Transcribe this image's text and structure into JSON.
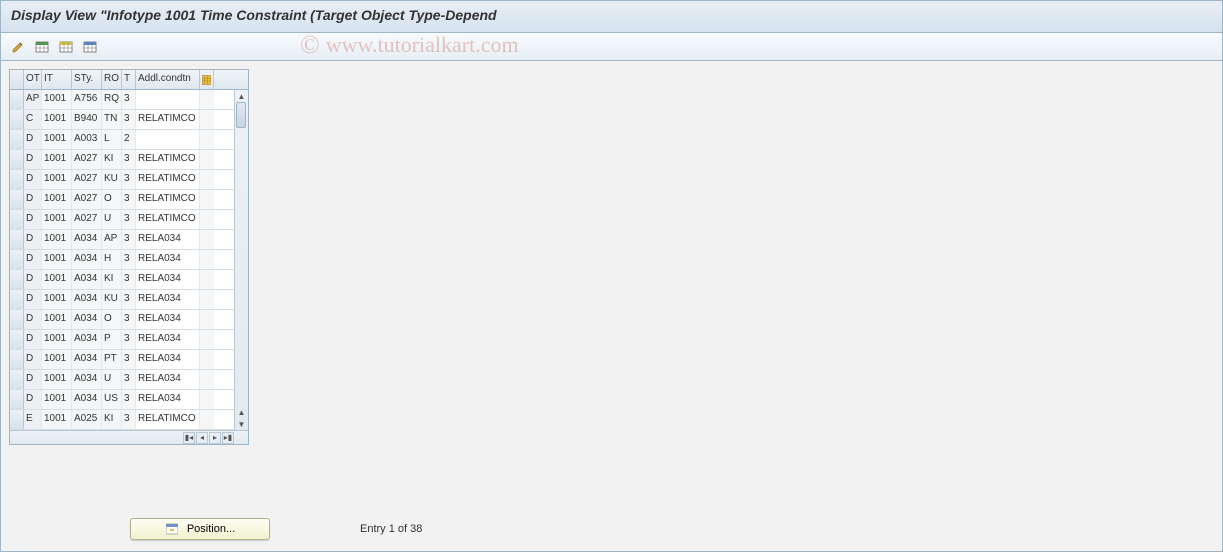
{
  "title": "Display View \"Infotype 1001 Time Constraint (Target Object Type-Depend",
  "watermark": "www.tutorialkart.com",
  "toolbar": {
    "icons": [
      "pencil-icon",
      "table-green-icon",
      "table-yellow-icon",
      "table-blue-icon"
    ]
  },
  "columns": {
    "ot": "OT",
    "it": "IT",
    "sty": "STy.",
    "ro": "RO",
    "t": "T",
    "ac": "Addl.condtn"
  },
  "rows": [
    {
      "ot": "AP",
      "it": "1001",
      "sty": "A756",
      "ro": "RQ",
      "t": "3",
      "ac": ""
    },
    {
      "ot": "C",
      "it": "1001",
      "sty": "B940",
      "ro": "TN",
      "t": "3",
      "ac": "RELATIMCO"
    },
    {
      "ot": "D",
      "it": "1001",
      "sty": "A003",
      "ro": "L",
      "t": "2",
      "ac": ""
    },
    {
      "ot": "D",
      "it": "1001",
      "sty": "A027",
      "ro": "KI",
      "t": "3",
      "ac": "RELATIMCO"
    },
    {
      "ot": "D",
      "it": "1001",
      "sty": "A027",
      "ro": "KU",
      "t": "3",
      "ac": "RELATIMCO"
    },
    {
      "ot": "D",
      "it": "1001",
      "sty": "A027",
      "ro": "O",
      "t": "3",
      "ac": "RELATIMCO"
    },
    {
      "ot": "D",
      "it": "1001",
      "sty": "A027",
      "ro": "U",
      "t": "3",
      "ac": "RELATIMCO"
    },
    {
      "ot": "D",
      "it": "1001",
      "sty": "A034",
      "ro": "AP",
      "t": "3",
      "ac": "RELA034"
    },
    {
      "ot": "D",
      "it": "1001",
      "sty": "A034",
      "ro": "H",
      "t": "3",
      "ac": "RELA034"
    },
    {
      "ot": "D",
      "it": "1001",
      "sty": "A034",
      "ro": "KI",
      "t": "3",
      "ac": "RELA034"
    },
    {
      "ot": "D",
      "it": "1001",
      "sty": "A034",
      "ro": "KU",
      "t": "3",
      "ac": "RELA034"
    },
    {
      "ot": "D",
      "it": "1001",
      "sty": "A034",
      "ro": "O",
      "t": "3",
      "ac": "RELA034"
    },
    {
      "ot": "D",
      "it": "1001",
      "sty": "A034",
      "ro": "P",
      "t": "3",
      "ac": "RELA034"
    },
    {
      "ot": "D",
      "it": "1001",
      "sty": "A034",
      "ro": "PT",
      "t": "3",
      "ac": "RELA034"
    },
    {
      "ot": "D",
      "it": "1001",
      "sty": "A034",
      "ro": "U",
      "t": "3",
      "ac": "RELA034"
    },
    {
      "ot": "D",
      "it": "1001",
      "sty": "A034",
      "ro": "US",
      "t": "3",
      "ac": "RELA034"
    },
    {
      "ot": "E",
      "it": "1001",
      "sty": "A025",
      "ro": "KI",
      "t": "3",
      "ac": "RELATIMCO"
    }
  ],
  "footer": {
    "position_label": "Position...",
    "entry_text": "Entry 1 of 38"
  }
}
